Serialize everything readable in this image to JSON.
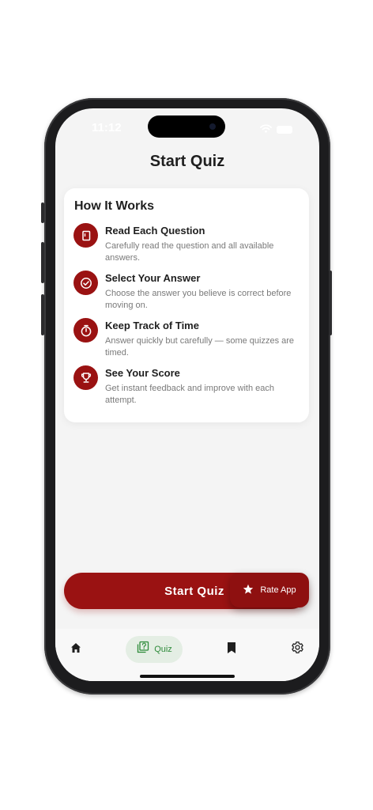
{
  "status_bar": {
    "time": "11:12"
  },
  "header": {
    "title": "Start Quiz"
  },
  "how_it_works": {
    "title": "How It Works",
    "steps": [
      {
        "icon": "book-icon",
        "title": "Read Each Question",
        "description": "Carefully read the question and all available answers."
      },
      {
        "icon": "check-circle-icon",
        "title": "Select Your Answer",
        "description": "Choose the answer you believe is correct before moving on."
      },
      {
        "icon": "timer-icon",
        "title": "Keep Track of Time",
        "description": "Answer quickly but carefully — some quizzes are timed."
      },
      {
        "icon": "trophy-icon",
        "title": "See Your Score",
        "description": "Get instant feedback and improve with each attempt."
      }
    ]
  },
  "actions": {
    "start_label": "Start Quiz",
    "rate_label": "Rate App"
  },
  "tabs": [
    {
      "icon": "home-icon",
      "label": ""
    },
    {
      "icon": "quiz-icon",
      "label": "Quiz",
      "active": true
    },
    {
      "icon": "bookmark-icon",
      "label": ""
    },
    {
      "icon": "gear-icon",
      "label": ""
    }
  ],
  "colors": {
    "primary": "#9a1212",
    "active_tab_bg": "#e4eee4",
    "active_tab_text": "#2e8b3a",
    "background": "#f4f4f4"
  }
}
